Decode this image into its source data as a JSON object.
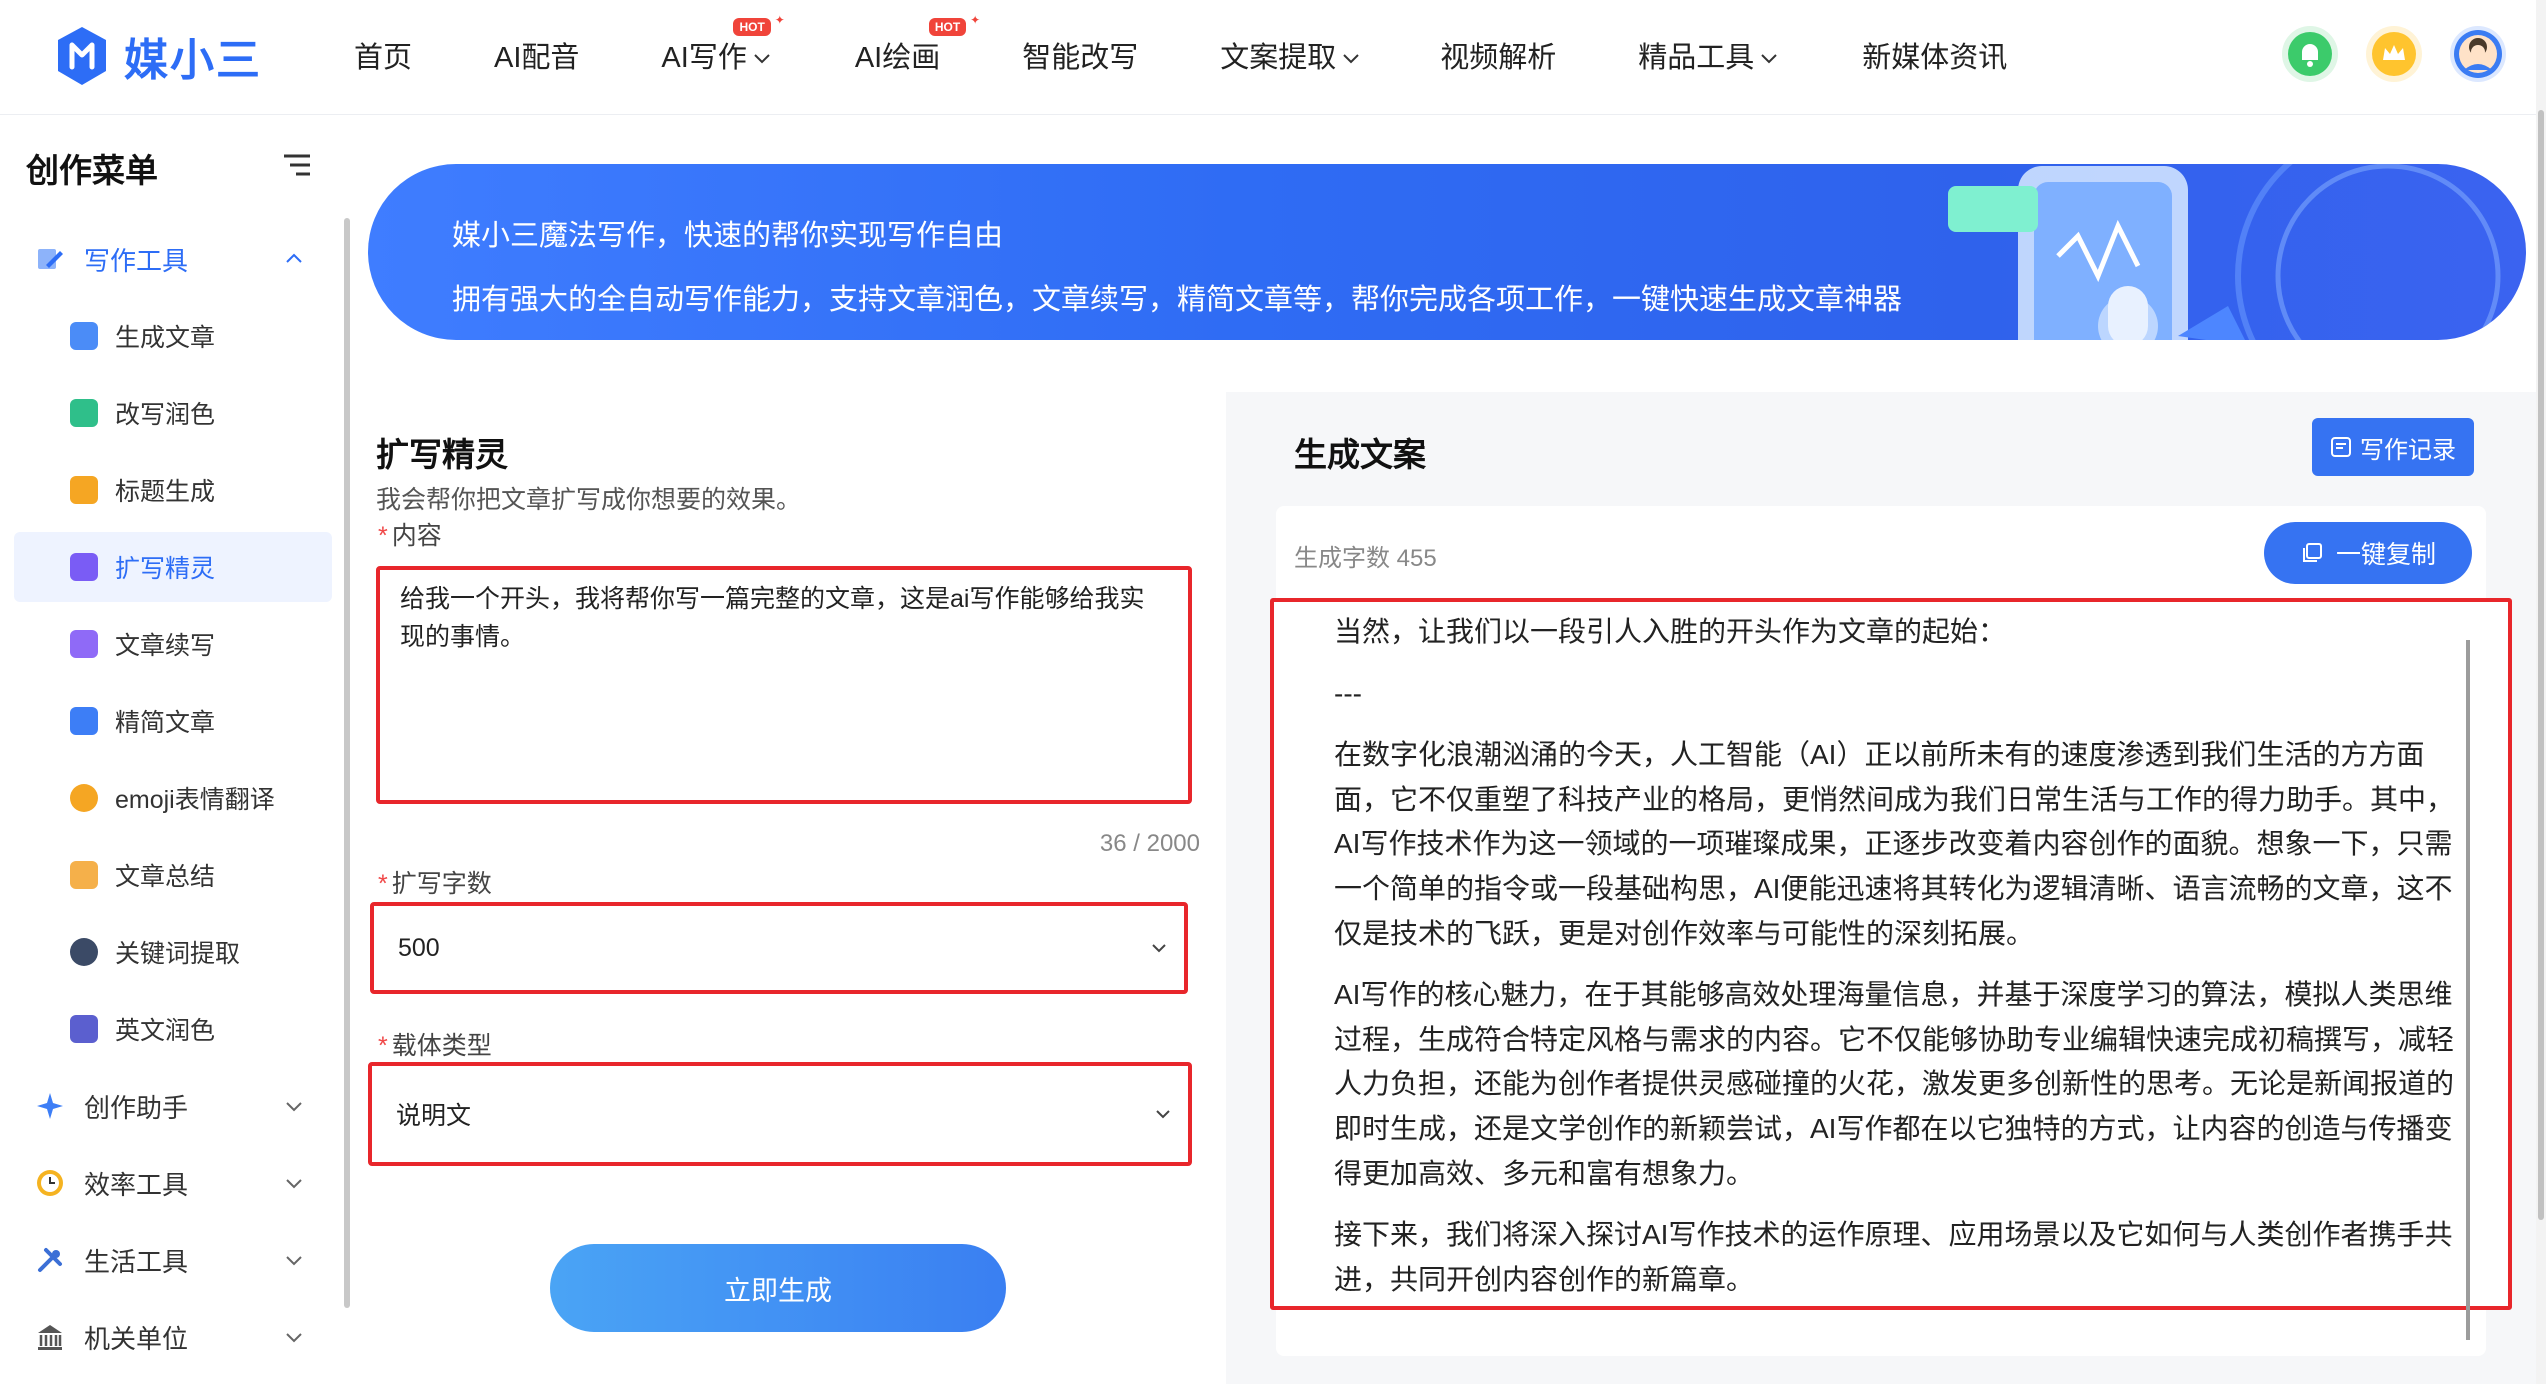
{
  "brand": {
    "name": "媒小三"
  },
  "nav": [
    {
      "label": "首页",
      "chevron": false,
      "hot": false
    },
    {
      "label": "AI配音",
      "chevron": false,
      "hot": false
    },
    {
      "label": "AI写作",
      "chevron": true,
      "hot": true
    },
    {
      "label": "AI绘画",
      "chevron": false,
      "hot": true
    },
    {
      "label": "智能改写",
      "chevron": false,
      "hot": false
    },
    {
      "label": "文案提取",
      "chevron": true,
      "hot": false
    },
    {
      "label": "视频解析",
      "chevron": false,
      "hot": false
    },
    {
      "label": "精品工具",
      "chevron": true,
      "hot": false
    },
    {
      "label": "新媒体资讯",
      "chevron": false,
      "hot": false
    }
  ],
  "hot_badge": "HOT",
  "top_icons": [
    "bell-icon",
    "crown-icon",
    "avatar"
  ],
  "sidebar": {
    "title": "创作菜单",
    "groups": [
      {
        "label": "写作工具",
        "icon": "edit-icon",
        "open": true
      },
      {
        "label": "创作助手",
        "icon": "sparkle-icon",
        "open": false
      },
      {
        "label": "效率工具",
        "icon": "clock-icon",
        "open": false
      },
      {
        "label": "生活工具",
        "icon": "tools-icon",
        "open": false
      },
      {
        "label": "机关单位",
        "icon": "building-icon",
        "open": false
      }
    ],
    "items": [
      {
        "label": "生成文章",
        "color": "#4b8cf7"
      },
      {
        "label": "改写润色",
        "color": "#2fbf8a"
      },
      {
        "label": "标题生成",
        "color": "#f5a623"
      },
      {
        "label": "扩写精灵",
        "color": "#7a5cf5"
      },
      {
        "label": "文章续写",
        "color": "#8f6af7"
      },
      {
        "label": "精简文章",
        "color": "#3d7ef6"
      },
      {
        "label": "emoji表情翻译",
        "color": "#f5a623"
      },
      {
        "label": "文章总结",
        "color": "#f5b04a"
      },
      {
        "label": "关键词提取",
        "color": "#3b4a66"
      },
      {
        "label": "英文润色",
        "color": "#5b5fcf"
      }
    ],
    "active_index": 3
  },
  "banner": {
    "line1": "媒小三魔法写作，快速的帮你实现写作自由",
    "line2": "拥有强大的全自动写作能力，支持文章润色，文章续写，精简文章等，帮你完成各项工作，一键快速生成文章神器"
  },
  "form": {
    "title": "扩写精灵",
    "desc": "我会帮你把文章扩写成你想要的效果。",
    "content_label": "内容",
    "content_value": "给我一个开头，我将帮你写一篇完整的文章，这是ai写作能够给我实现的事情。",
    "counter": "36 / 2000",
    "words_label": "扩写字数",
    "words_value": "500",
    "type_label": "载体类型",
    "type_value": "说明文",
    "required_mark": "*",
    "generate_label": "立即生成"
  },
  "output": {
    "title": "生成文案",
    "record_label": "写作记录",
    "count_label": "生成字数 455",
    "copy_label": "一键复制",
    "paragraphs": [
      "当然，让我们以一段引人入胜的开头作为文章的起始：",
      "---",
      "在数字化浪潮汹涌的今天，人工智能（AI）正以前所未有的速度渗透到我们生活的方方面面，它不仅重塑了科技产业的格局，更悄然间成为我们日常生活与工作的得力助手。其中，AI写作技术作为这一领域的一项璀璨成果，正逐步改变着内容创作的面貌。想象一下，只需一个简单的指令或一段基础构思，AI便能迅速将其转化为逻辑清晰、语言流畅的文章，这不仅是技术的飞跃，更是对创作效率与可能性的深刻拓展。",
      "AI写作的核心魅力，在于其能够高效处理海量信息，并基于深度学习的算法，模拟人类思维过程，生成符合特定风格与需求的内容。它不仅能够协助专业编辑快速完成初稿撰写，减轻人力负担，还能为创作者提供灵感碰撞的火花，激发更多创新性的思考。无论是新闻报道的即时生成，还是文学创作的新颖尝试，AI写作都在以它独特的方式，让内容的创造与传播变得更加高效、多元和富有想象力。",
      "接下来，我们将深入探讨AI写作技术的运作原理、应用场景以及它如何与人类创作者携手共进，共同开创内容创作的新篇章。"
    ]
  },
  "colors": {
    "accent": "#2d6df6",
    "highlight_border": "#e8262b"
  }
}
